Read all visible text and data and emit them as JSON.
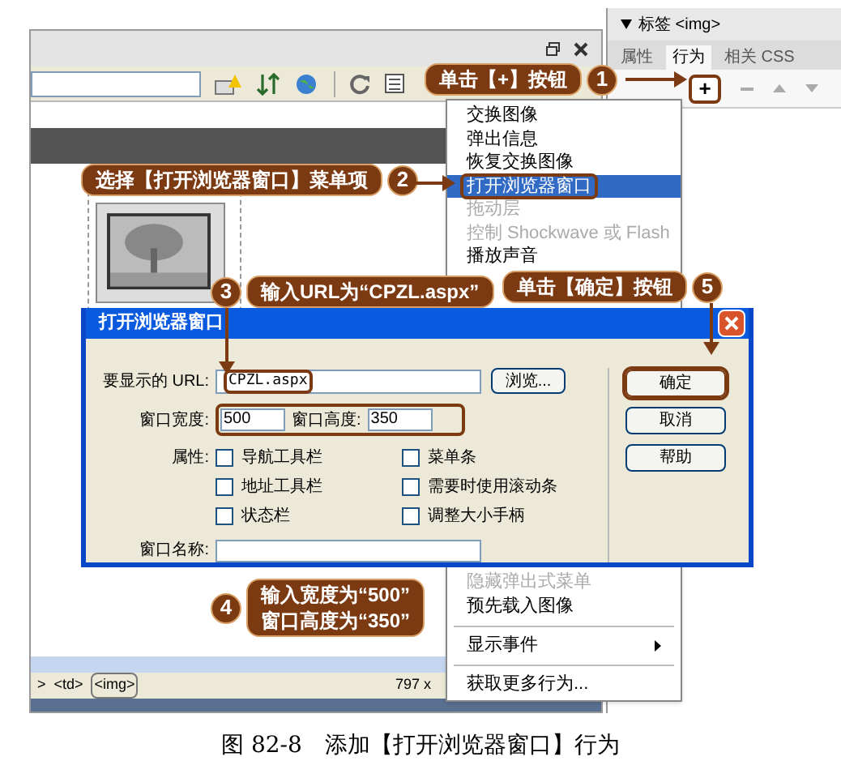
{
  "panel": {
    "title": "标签 <img>",
    "tabs": [
      {
        "label": "属性",
        "selected": false
      },
      {
        "label": "行为",
        "selected": true
      },
      {
        "label": "相关 CSS",
        "selected": false
      }
    ],
    "add_button": "+"
  },
  "menu": {
    "items_top": [
      {
        "label": "交换图像",
        "disabled": false,
        "selected": false
      },
      {
        "label": "弹出信息",
        "disabled": false,
        "selected": false
      },
      {
        "label": "恢复交换图像",
        "disabled": false,
        "selected": false
      },
      {
        "label": "打开浏览器窗口",
        "disabled": false,
        "selected": true
      },
      {
        "label": "拖动层",
        "disabled": true,
        "selected": false
      },
      {
        "label": "控制 Shockwave 或 Flash",
        "disabled": true,
        "selected": false
      },
      {
        "label": "播放声音",
        "disabled": false,
        "selected": false
      }
    ],
    "items_bottom": [
      {
        "kind": "item",
        "label": "隐藏弹出式菜单",
        "disabled": true
      },
      {
        "kind": "item",
        "label": "预先载入图像",
        "disabled": false
      },
      {
        "kind": "separator"
      },
      {
        "kind": "submenu",
        "label": "显示事件",
        "disabled": false
      },
      {
        "kind": "separator"
      },
      {
        "kind": "item",
        "label": "获取更多行为...",
        "disabled": false
      }
    ]
  },
  "dialog": {
    "title": "打开浏览器窗口",
    "url_label": "要显示的 URL:",
    "url_value": "CPZL.aspx",
    "browse_button": "浏览...",
    "width_label": "窗口宽度:",
    "width_value": "500",
    "height_label": "窗口高度:",
    "height_value": "350",
    "attributes_label": "属性:",
    "options": [
      {
        "label": "导航工具栏",
        "checked": false
      },
      {
        "label": "菜单条",
        "checked": false
      },
      {
        "label": "地址工具栏",
        "checked": false
      },
      {
        "label": "需要时使用滚动条",
        "checked": false
      },
      {
        "label": "状态栏",
        "checked": false
      },
      {
        "label": "调整大小手柄",
        "checked": false
      }
    ],
    "name_label": "窗口名称:",
    "buttons": [
      "确定",
      "取消",
      "帮助"
    ]
  },
  "status_bar": {
    "prefix": ">",
    "tags": [
      {
        "label": "<td>",
        "selected": false
      },
      {
        "label": "<img>",
        "selected": true
      }
    ],
    "size": "797 x"
  },
  "callouts": [
    {
      "number": "1",
      "lines": [
        "单击【+】按钮"
      ]
    },
    {
      "number": "2",
      "lines": [
        "选择【打开浏览器窗口】菜单项"
      ]
    },
    {
      "number": "3",
      "lines": [
        "输入URL为“CPZL.aspx”"
      ]
    },
    {
      "number": "4",
      "lines": [
        "输入宽度为“500”",
        "窗口高度为“350”"
      ]
    },
    {
      "number": "5",
      "lines": [
        "单击【确定】按钮"
      ]
    }
  ],
  "caption": "图 82-8　添加【打开浏览器窗口】行为"
}
